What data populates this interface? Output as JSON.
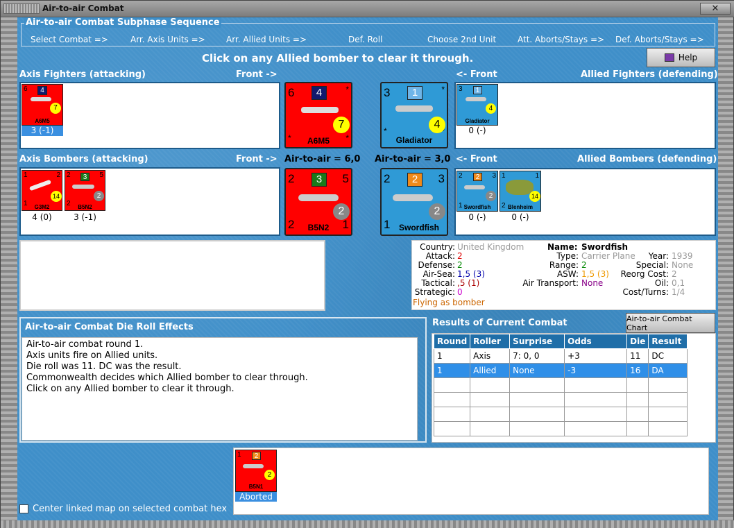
{
  "window": {
    "title": "Air-to-air Combat",
    "close": "✕"
  },
  "sequence": {
    "title": "Air-to-air Combat Subphase Sequence",
    "steps": [
      "Select Combat =>",
      "Arr. Axis Units =>",
      "Arr. Allied Units =>",
      "Def. Roll",
      "Choose 2nd Unit",
      "Att. Aborts/Stays =>",
      "Def. Aborts/Stays =>"
    ]
  },
  "instruction": "Click on any Allied bomber to clear it through.",
  "help_label": "Help",
  "axis_fighters": {
    "title": "Axis Fighters (attacking)",
    "front": "Front ->",
    "units": [
      {
        "name": "A6M5",
        "left": "6",
        "sq": "4",
        "circ": "7",
        "label": "3 (-1)",
        "selected": true
      }
    ]
  },
  "allied_fighters": {
    "title": "Allied Fighters (defending)",
    "front": "<- Front",
    "units": [
      {
        "name": "Gladiator",
        "left": "3",
        "sq": "1",
        "circ": "4",
        "label": "0 (-)"
      }
    ]
  },
  "axis_bombers": {
    "title": "Axis Bombers (attacking)",
    "front": "Front ->",
    "air_to_air": "Air-to-air = 6,0",
    "units": [
      {
        "name": "G3M2",
        "left": "1",
        "right": "2",
        "bottom": "1",
        "circ": "14",
        "label": "4 (0)"
      },
      {
        "name": "B5N2",
        "left": "2",
        "right": "5",
        "bottom": "2",
        "sq": "3",
        "circ": "2",
        "label": "3 (-1)"
      }
    ]
  },
  "allied_bombers": {
    "title": "Allied Bombers (defending)",
    "front": "<- Front",
    "air_to_air": "Air-to-air = 3,0",
    "units": [
      {
        "name": "Swordfish",
        "left": "2",
        "right": "3",
        "bottom": "1",
        "sq": "2",
        "circ": "2",
        "label": "0 (-)"
      },
      {
        "name": "Blenheim",
        "left": "1",
        "right": "1",
        "bottom": "2",
        "circ": "14",
        "label": "0 (-)"
      }
    ]
  },
  "big_axis_fighter": {
    "name": "A6M5",
    "left": "6",
    "sq": "4",
    "circ": "7"
  },
  "big_allied_fighter": {
    "name": "Gladiator",
    "left": "3",
    "sq": "1",
    "circ": "4"
  },
  "big_axis_bomber": {
    "name": "B5N2",
    "left": "2",
    "right": "5",
    "bottom": "2",
    "bottom_right": "1",
    "sq": "3",
    "circ": "2"
  },
  "big_allied_bomber": {
    "name": "Swordfish",
    "left": "2",
    "right": "3",
    "bottom": "1",
    "sq": "2",
    "circ": "2"
  },
  "info": {
    "country_label": "Country:",
    "country": "United Kingdom",
    "attack_label": "Attack:",
    "attack": "2",
    "defense_label": "Defense:",
    "defense": "2",
    "airsea_label": "Air-Sea:",
    "airsea": "1,5 (3)",
    "tactical_label": "Tactical:",
    "tactical": ",5 (1)",
    "strategic_label": "Strategic:",
    "strategic": "0",
    "flying": "Flying as bomber",
    "name_label": "Name:",
    "name": "Swordfish",
    "type_label": "Type:",
    "type": "Carrier Plane",
    "range_label": "Range:",
    "range": "2",
    "asw_label": "ASW:",
    "asw": "1,5 (3)",
    "airtransport_label": "Air Transport:",
    "airtransport": "None",
    "year_label": "Year:",
    "year": "1939",
    "special_label": "Special:",
    "special": "None",
    "reorg_label": "Reorg Cost:",
    "reorg": "2",
    "oil_label": "Oil:",
    "oil": "0,1",
    "costturns_label": "Cost/Turns:",
    "costturns": "1/4"
  },
  "die_effects": {
    "title": "Air-to-air Combat Die Roll Effects",
    "lines": [
      "Air-to-air combat round 1.",
      "Axis units fire on Allied units.",
      "Die roll was 11.  DC was the result.",
      "Commonwealth decides which Allied bomber to clear through.",
      "Click on any Allied bomber to clear it through."
    ]
  },
  "results": {
    "title": "Results of Current Combat",
    "chart_button": "Air-to-air Combat Chart",
    "headers": [
      "Round",
      "Roller",
      "Surprise",
      "Odds",
      "Die",
      "Result"
    ],
    "rows": [
      [
        "1",
        "Axis",
        "7: 0, 0",
        "+3",
        "11",
        "DC"
      ],
      [
        "1",
        "Allied",
        "None",
        "-3",
        "16",
        "DA"
      ]
    ]
  },
  "aborted": {
    "name": "B5N1",
    "left": "1",
    "sq": "2",
    "circ": "2",
    "label": "Aborted"
  },
  "center_map_label": "Center linked map on selected combat hex",
  "colors": {
    "axis": "#ff0000",
    "allied": "#2f9ad6",
    "selected": "#3a8fe0"
  }
}
